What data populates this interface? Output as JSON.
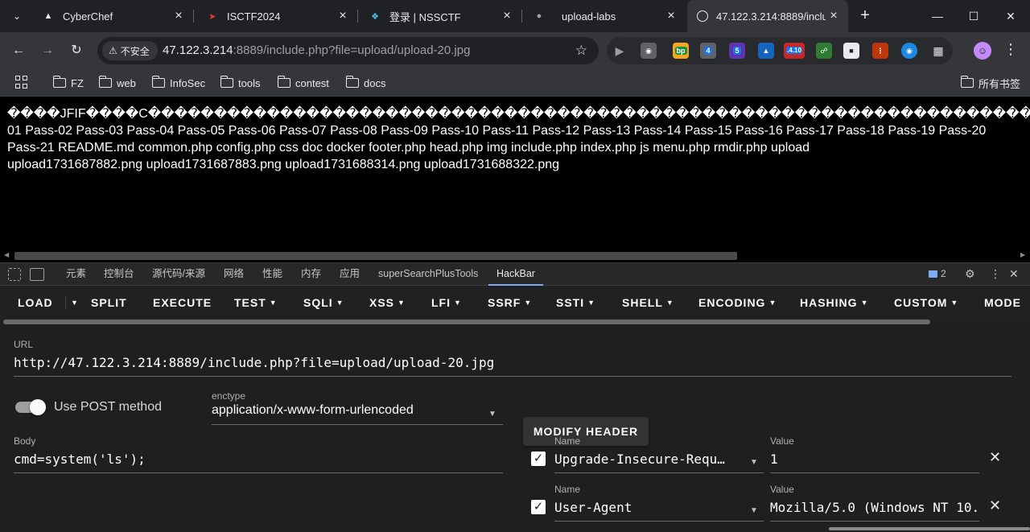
{
  "browser": {
    "tabs": [
      {
        "title": "CyberChef",
        "icon": "cyberchef-icon",
        "color": "#e8eaed"
      },
      {
        "title": "ISCTF2024",
        "icon": "isctf-icon",
        "color": "#e53935"
      },
      {
        "title": "登录 | NSSCTF",
        "icon": "nssctf-icon",
        "color": "#4fc3f7"
      },
      {
        "title": "upload-labs",
        "icon": "github-icon",
        "color": "#9aa0a6"
      },
      {
        "title": "47.122.3.214:8889/inclu",
        "icon": "globe-icon",
        "color": "#e8eaed"
      }
    ],
    "newtab_glyph": "+",
    "window_controls": {
      "minimize": "—",
      "maximize": "☐",
      "close": "✕"
    },
    "security_label": "不安全",
    "url_host": "47.122.3.214",
    "url_rest": ":8889/include.php?file=upload/upload-20.jpg",
    "extension_badges": [
      "bp",
      "4",
      "5",
      ".4.10"
    ],
    "bookmarks": {
      "left": [
        "FZ",
        "web",
        "InfoSec",
        "tools",
        "contest",
        "docs"
      ],
      "right": "所有书签"
    }
  },
  "page": {
    "lines": [
      "����JFIF����C������������������������������������������������������������������������������������������������������������������������C������������������������������������������������������������������������������������������������������������",
      "01 Pass-02 Pass-03 Pass-04 Pass-05 Pass-06 Pass-07 Pass-08 Pass-09 Pass-10 Pass-11 Pass-12 Pass-13 Pass-14 Pass-15 Pass-16 Pass-17 Pass-18 Pass-19 Pass-20",
      "Pass-21 README.md common.php config.php css doc docker footer.php head.php img include.php index.php js menu.php rmdir.php upload",
      "upload1731687882.png upload1731687883.png upload1731688314.png upload1731688322.png"
    ]
  },
  "devtools": {
    "tabs": [
      "元素",
      "控制台",
      "源代码/来源",
      "网络",
      "性能",
      "内存",
      "应用",
      "superSearchPlusTools",
      "HackBar"
    ],
    "active_tab": "HackBar",
    "message_count": "2"
  },
  "hackbar": {
    "menu": [
      {
        "label": "LOAD",
        "caret": false
      },
      {
        "label": "SPLIT",
        "caret": false
      },
      {
        "label": "EXECUTE",
        "caret": false
      },
      {
        "label": "TEST",
        "caret": true
      },
      {
        "label": "SQLI",
        "caret": true
      },
      {
        "label": "XSS",
        "caret": true
      },
      {
        "label": "LFI",
        "caret": true
      },
      {
        "label": "SSRF",
        "caret": true
      },
      {
        "label": "SSTI",
        "caret": true
      },
      {
        "label": "SHELL",
        "caret": true
      },
      {
        "label": "ENCODING",
        "caret": true
      },
      {
        "label": "HASHING",
        "caret": true
      },
      {
        "label": "CUSTOM",
        "caret": true
      },
      {
        "label": "MODE",
        "caret": false
      }
    ],
    "url_label": "URL",
    "url_value": "http://47.122.3.214:8889/include.php?file=upload/upload-20.jpg",
    "post_toggle_label": "Use POST method",
    "post_enabled": true,
    "enctype_label": "enctype",
    "enctype_value": "application/x-www-form-urlencoded",
    "modify_header_label": "MODIFY HEADER",
    "body_label": "Body",
    "body_value": "cmd=system('ls');",
    "headers": [
      {
        "name_label": "Name",
        "name": "Upgrade-Insecure-Requ…",
        "value_label": "Value",
        "value": "1",
        "enabled": true
      },
      {
        "name_label": "Name",
        "name": "User-Agent",
        "value_label": "Value",
        "value": "Mozilla/5.0 (Windows NT 10.",
        "enabled": true
      }
    ]
  },
  "colors": {
    "accent_blue": "#7cacf8",
    "chrome_dark": "#202124",
    "toolbar": "#35363a",
    "hackbar_bg": "#1f1f1f"
  }
}
